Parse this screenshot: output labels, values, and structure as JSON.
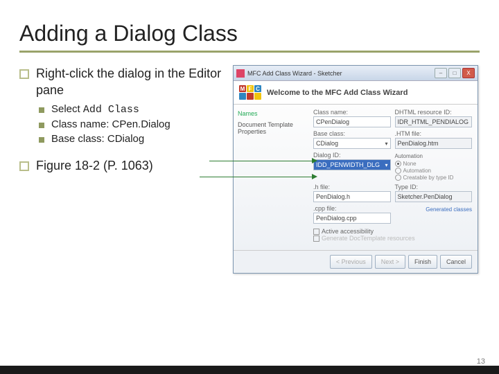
{
  "slide": {
    "title": "Adding a Dialog Class",
    "page_number": "13"
  },
  "bullets": {
    "b1": "Right-click the dialog in the Editor pane",
    "b1_sub": {
      "s1_prefix": "Select ",
      "s1_code": "Add Class",
      "s2": "Class name: CPen.Dialog",
      "s3": "Base class: CDialog"
    },
    "b2": "Figure 18-2 (P. 1063)"
  },
  "wizard": {
    "titlebar": "MFC Add Class Wizard - Sketcher",
    "header_title": "Welcome to the MFC Add Class Wizard",
    "side": {
      "names": "Names",
      "doc_props": "Document Template Properties"
    },
    "labels": {
      "class_name": "Class name:",
      "dhtml_id": "DHTML resource ID:",
      "base_class": "Base class:",
      "htm_file": ".HTM file:",
      "dialog_id": "Dialog ID:",
      "h_file": ".h file:",
      "cpp_file": ".cpp file:",
      "automation": "Automation",
      "type_id": "Type ID:"
    },
    "values": {
      "class_name": "CPenDialog",
      "dhtml_id": "IDR_HTML_PENDIALOG",
      "base_class": "CDialog",
      "htm_file": "PenDialog.htm",
      "dialog_id": "IDD_PENWIDTH_DLG",
      "h_file": "PenDialog.h",
      "cpp_file": "PenDialog.cpp",
      "type_id": "Sketcher.PenDialog"
    },
    "radios": {
      "none": "None",
      "auto": "Automation",
      "creatable": "Creatable by type ID"
    },
    "checks": {
      "active_acc": "Active accessibility",
      "gen_res": "Generate DocTemplate resources"
    },
    "gen_link": "Generated classes",
    "buttons": {
      "prev": "< Previous",
      "next": "Next >",
      "finish": "Finish",
      "cancel": "Cancel"
    },
    "win_controls": {
      "min": "–",
      "max": "□",
      "close": "X"
    }
  }
}
